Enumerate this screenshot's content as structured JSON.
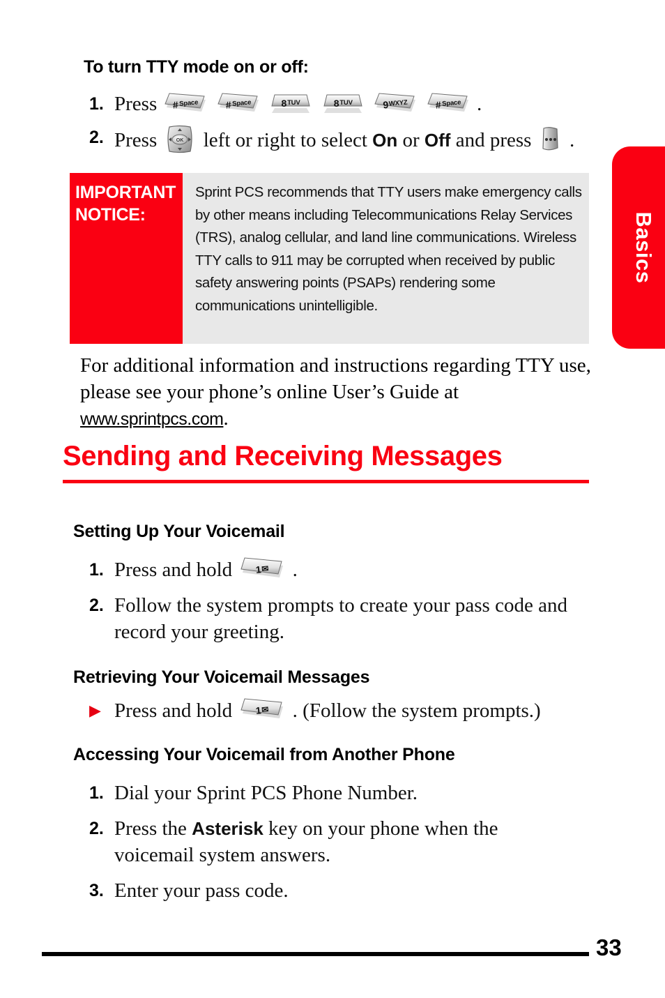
{
  "side_tab": {
    "label": "Basics"
  },
  "page": {
    "number": "33"
  },
  "tty": {
    "heading": "To turn TTY mode on or off:",
    "steps": [
      {
        "num": "1.",
        "pre": "Press",
        "post": "."
      },
      {
        "num": "2.",
        "pre": "Press",
        "mid_a": "left or right to select",
        "on": "On",
        "or": "or",
        "off": "Off",
        "mid_b": "and press",
        "post": "."
      }
    ],
    "keys_step1": [
      {
        "name": "hash-space-key",
        "digit": "#",
        "sub": "Space",
        "shape": "slanted"
      },
      {
        "name": "hash-space-key",
        "digit": "#",
        "sub": "Space",
        "shape": "slanted"
      },
      {
        "name": "eight-tuv-key",
        "digit": "8",
        "sub": "TUV",
        "shape": "trapezoid"
      },
      {
        "name": "eight-tuv-key",
        "digit": "8",
        "sub": "TUV",
        "shape": "trapezoid"
      },
      {
        "name": "nine-wxyz-key",
        "digit": "9",
        "sub": "WXYZ",
        "shape": "slanted"
      },
      {
        "name": "hash-space-key",
        "digit": "#",
        "sub": "Space",
        "shape": "slanted"
      }
    ],
    "nav_key": {
      "name": "navigation-ok-key",
      "label": "OK"
    },
    "soft_key": {
      "name": "right-softkey",
      "label": "•••"
    }
  },
  "notice": {
    "label": "IMPORTANT NOTICE:",
    "body": "Sprint PCS recommends that TTY users make emergency calls by other means including Telecommunications Relay Services (TRS), analog cellular, and land line communications. Wireless TTY calls to 911 may be corrupted when received by public safety answering points (PSAPs) rendering some communications unintelligible."
  },
  "paragraph": {
    "text_before_url": "For additional information and instructions regarding TTY use, please see your phone’s online User’s Guide at ",
    "url": "www.sprintpcs.com",
    "text_after_url": "."
  },
  "section": {
    "title": "Sending and Receiving Messages"
  },
  "setup_voicemail": {
    "heading": "Setting Up Your Voicemail",
    "step1": {
      "num": "1.",
      "pre": "Press and hold",
      "post": "."
    },
    "step2": {
      "num": "2.",
      "text": "Follow the system prompts to create your pass code and record your greeting."
    }
  },
  "retrieving_voicemail": {
    "heading": "Retrieving Your Voicemail Messages",
    "bullet": "▶",
    "pre": "Press and hold",
    "post": ". (Follow the system prompts.)"
  },
  "accessing_voicemail": {
    "heading": "Accessing Your Voicemail from Another Phone",
    "steps": [
      {
        "num": "1.",
        "text": "Dial your Sprint PCS Phone Number."
      },
      {
        "num": "2.",
        "pre": "Press the",
        "bold": "Asterisk",
        "post": "key on your phone when the voicemail system answers."
      },
      {
        "num": "3.",
        "text": "Enter your pass code."
      }
    ]
  },
  "voicemail_key": {
    "name": "one-voicemail-key",
    "digit": "1",
    "icon": "✉"
  },
  "colors": {
    "brand_red": "#FA0012",
    "notice_grey": "#E8E8E8",
    "text_black": "#000000"
  }
}
